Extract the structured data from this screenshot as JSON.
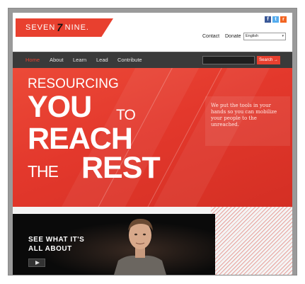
{
  "header": {
    "logo_text_left": "SEVEN",
    "logo_mark": "7",
    "logo_text_right": "NINE.",
    "social": [
      {
        "icon": "facebook-icon",
        "glyph": "f"
      },
      {
        "icon": "twitter-icon",
        "glyph": "t"
      },
      {
        "icon": "rss-icon",
        "glyph": "r"
      }
    ],
    "links": {
      "contact": "Contact",
      "donate": "Donate"
    },
    "language": {
      "selected": "English"
    }
  },
  "nav": {
    "items": [
      "Home",
      "About",
      "Learn",
      "Lead",
      "Contribute"
    ],
    "active": "Home",
    "search_button": "Search →"
  },
  "hero": {
    "line1": "RESOURCING",
    "line2a": "YOU",
    "line2b": "TO",
    "line3": "REACH",
    "line4a": "THE",
    "line4b": "REST",
    "tagline": "We put the tools in your hands so you can mobilize your people to the unreached."
  },
  "video": {
    "title_line1": "SEE WHAT IT'S",
    "title_line2": "ALL ABOUT"
  },
  "colors": {
    "accent": "#e8402f",
    "navbar": "#3a3a3a"
  }
}
